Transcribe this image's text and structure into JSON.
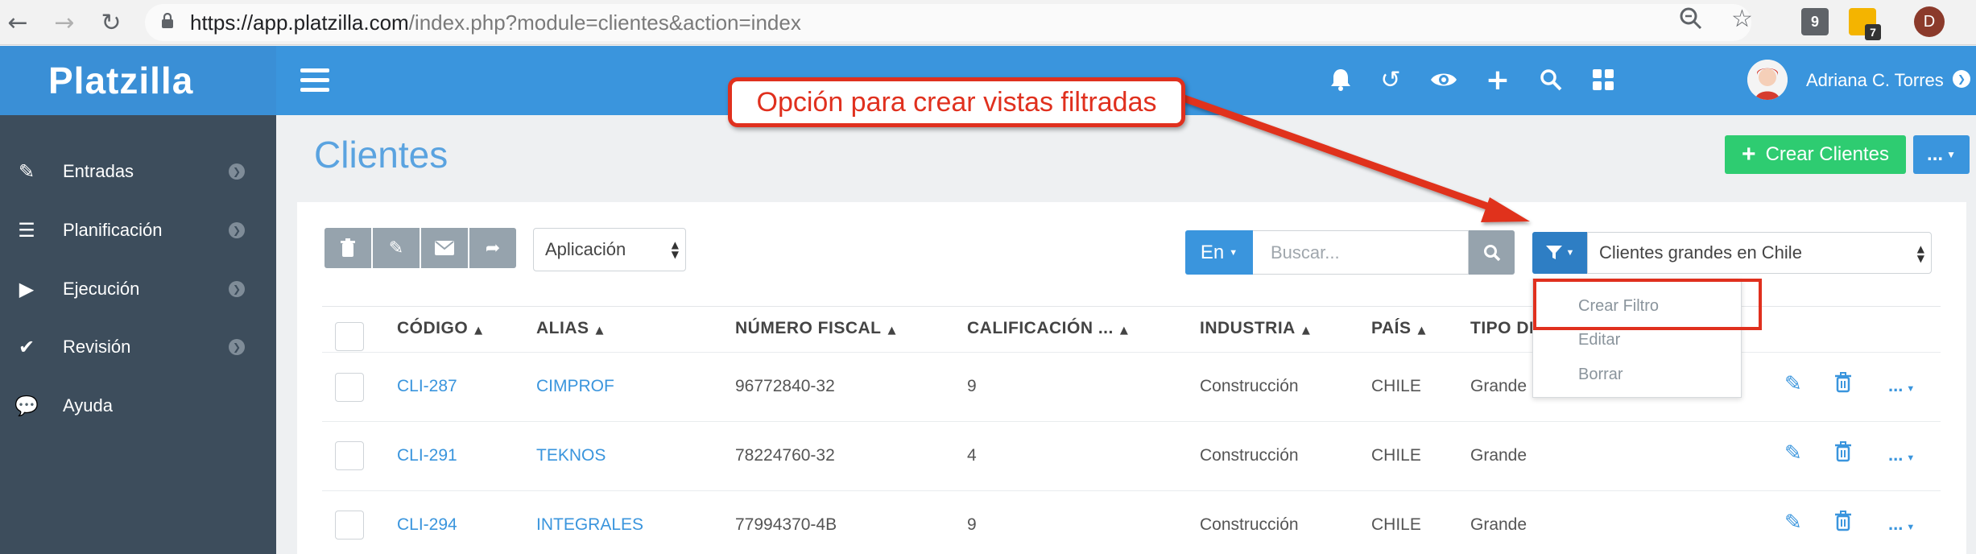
{
  "browser": {
    "url_host": "https://app.platzilla.com",
    "url_path": "/index.php?module=clientes&action=index",
    "ext_badge_1": "9",
    "ext_badge_2": "7",
    "profile_initial": "D"
  },
  "brand": "Platzilla",
  "sidebar": {
    "items": [
      {
        "label": "Entradas",
        "icon": "edit-icon"
      },
      {
        "label": "Planificación",
        "icon": "list-icon"
      },
      {
        "label": "Ejecución",
        "icon": "play-icon"
      },
      {
        "label": "Revisión",
        "icon": "check-icon"
      },
      {
        "label": "Ayuda",
        "icon": "chat-icon"
      }
    ]
  },
  "header": {
    "user_name": "Adriana C. Torres",
    "icons": [
      "bell-icon",
      "history-icon",
      "eye-icon",
      "plus-icon",
      "search-icon",
      "grid-icon"
    ]
  },
  "page": {
    "title": "Clientes",
    "create_label": "Crear Clientes",
    "more_label": "..."
  },
  "toolbar": {
    "application_select": "Aplicación",
    "search_scope": "En",
    "search_placeholder": "Buscar...",
    "filter_select": "Clientes grandes en Chile"
  },
  "filter_menu": {
    "items": [
      "Crear Filtro",
      "Editar",
      "Borrar"
    ]
  },
  "annotation": {
    "text": "Opción para crear vistas filtradas"
  },
  "table": {
    "columns": [
      "CÓDIGO",
      "ALIAS",
      "NÚMERO FISCAL",
      "CALIFICACIÓN ...",
      "INDUSTRIA",
      "PAÍS",
      "TIPO DE"
    ],
    "rows": [
      {
        "codigo": "CLI-287",
        "alias": "CIMPROF",
        "fiscal": "96772840-32",
        "calificacion": "9",
        "industria": "Construcción",
        "pais": "CHILE",
        "tipo": "Grande"
      },
      {
        "codigo": "CLI-291",
        "alias": "TEKNOS",
        "fiscal": "78224760-32",
        "calificacion": "4",
        "industria": "Construcción",
        "pais": "CHILE",
        "tipo": "Grande"
      },
      {
        "codigo": "CLI-294",
        "alias": "INTEGRALES",
        "fiscal": "77994370-4B",
        "calificacion": "9",
        "industria": "Construcción",
        "pais": "CHILE",
        "tipo": "Grande"
      }
    ],
    "row_more_label": "..."
  },
  "colors": {
    "brand_blue": "#3a95dd",
    "sidebar_bg": "#3d4d5c",
    "create_green": "#2ecc71",
    "annotation_red": "#e0301e"
  }
}
